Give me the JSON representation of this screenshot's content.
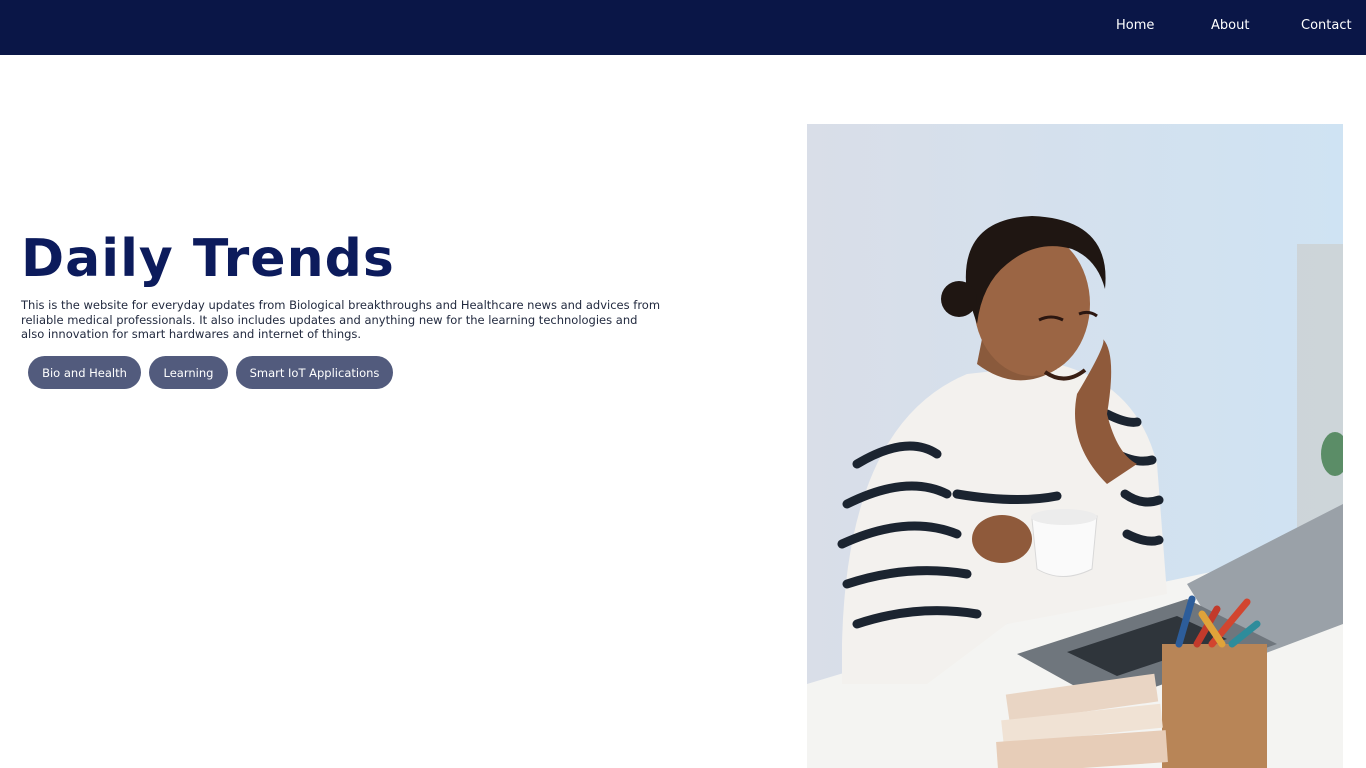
{
  "nav": {
    "home": "Home",
    "about": "About",
    "contact": "Contact"
  },
  "hero": {
    "title": "Daily Trends",
    "description": "This is the website for everyday updates from Biological breakthroughs and Healthcare news and advices from reliable medical professionals. It also includes updates and anything new for the learning technologies and also innovation for smart hardwares and internet of things."
  },
  "categories": [
    {
      "label": "Bio and Health"
    },
    {
      "label": "Learning"
    },
    {
      "label": "Smart IoT Applications"
    }
  ],
  "colors": {
    "navbar": "#0a1647",
    "title": "#0c1b5c",
    "button": "#525b7d"
  },
  "image": {
    "subject": "woman-with-coffee-at-laptop"
  }
}
